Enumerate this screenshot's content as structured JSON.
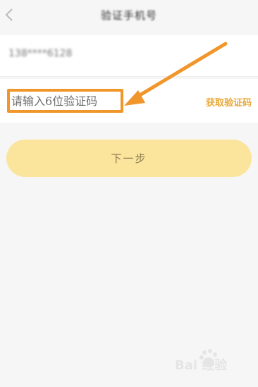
{
  "header": {
    "title": "验证手机号"
  },
  "phone_row": {
    "value": "138****6128"
  },
  "code_row": {
    "placeholder": "请输入6位验证码",
    "get_code_label": "获取验证码"
  },
  "next_button": {
    "label": "下一步"
  },
  "watermark": {
    "text": "Bai 经验"
  },
  "colors": {
    "accent_orange": "#f0962a",
    "button_yellow": "#fbe49c",
    "link_gold": "#e8a93a"
  }
}
